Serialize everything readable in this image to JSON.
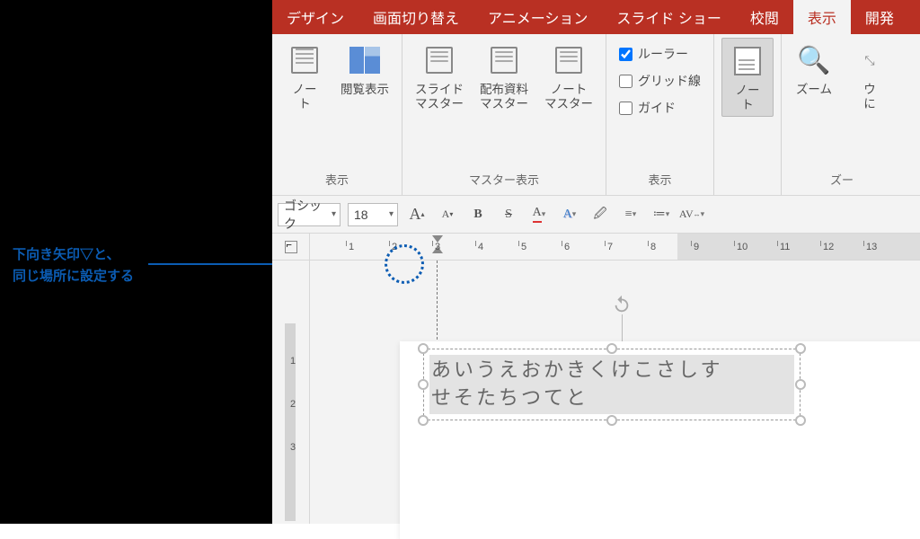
{
  "annotation": {
    "line1": "下向き矢印▽と、",
    "line2": "同じ場所に設定する"
  },
  "tabs": {
    "design": "デザイン",
    "transition": "画面切り替え",
    "animation": "アニメーション",
    "slideshow": "スライド ショー",
    "review": "校閲",
    "view": "表示",
    "develop": "開発"
  },
  "ribbon": {
    "note": "ノー\nト",
    "reading": "閲覧表示",
    "group1": "表示",
    "slideMaster": "スライド\nマスター",
    "handoutMaster": "配布資料\nマスター",
    "noteMaster": "ノート\nマスター",
    "group2": "マスター表示",
    "ruler": "ルーラー",
    "grid": "グリッド線",
    "guide": "ガイド",
    "group3": "表示",
    "notes": "ノー\nト",
    "zoom": "ズーム",
    "window": "ウ\nに",
    "group4": "ズー"
  },
  "format": {
    "font": "ゴシック",
    "size": "18",
    "bigA": "A",
    "smallA": "A",
    "bold": "B",
    "strike": "S",
    "redA": "A",
    "blueA": "A",
    "spacing": "AV"
  },
  "ruler": [
    "1",
    "2",
    "3",
    "4",
    "5",
    "6",
    "7",
    "8",
    "9",
    "10",
    "11",
    "12",
    "13"
  ],
  "rulerV": [
    "1",
    "2",
    "3"
  ],
  "textbox": {
    "line1": "あいうえおかきくけこさしす",
    "line2": "せそたちつてと"
  }
}
